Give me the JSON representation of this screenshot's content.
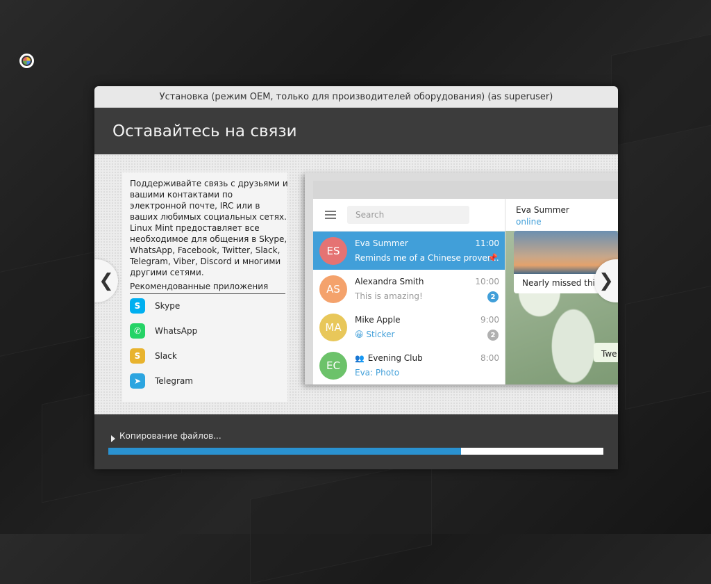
{
  "window": {
    "title": "Установка (режим OEM, только для производителей оборудования) (as superuser)"
  },
  "header": {
    "title": "Оставайтесь на связи"
  },
  "slide": {
    "description": "Поддерживайте связь с друзьями и вашими контактами по электронной почте, IRC или в ваших любимых социальных сетях. Linux Mint предоставляет все необходимое для общения в Skype, WhatsApp, Facebook, Twitter, Slack, Telegram, Viber, Discord и многими другими сетями.",
    "recommended_title": "Рекомендованные приложения",
    "apps": [
      {
        "name": "Skype",
        "icon": "skype-icon",
        "color": "#00aff0",
        "glyph": "S"
      },
      {
        "name": "WhatsApp",
        "icon": "whatsapp-icon",
        "color": "#25d366",
        "glyph": "✆"
      },
      {
        "name": "Slack",
        "icon": "slack-icon",
        "color": "#e8b32e",
        "glyph": "S"
      },
      {
        "name": "Telegram",
        "icon": "telegram-icon",
        "color": "#2ca5e0",
        "glyph": "➤"
      }
    ],
    "mock": {
      "search_placeholder": "Search",
      "chats": [
        {
          "initials": "ES",
          "name": "Eva Summer",
          "time": "11:00",
          "msg": "Reminds me of a Chinese prover…",
          "avatar_color": "#e57373",
          "active": true,
          "pinned": true
        },
        {
          "initials": "AS",
          "name": "Alexandra Smith",
          "time": "10:00",
          "msg": "This is amazing!",
          "avatar_color": "#f4a26c",
          "badge": "2",
          "badge_color": "#419fd9"
        },
        {
          "initials": "MA",
          "name": "Mike Apple",
          "time": "9:00",
          "msg": "😀 Sticker",
          "avatar_color": "#e8c75a",
          "badge": "2",
          "badge_color": "#b0b0b0"
        },
        {
          "initials": "EC",
          "name": "Evening Club",
          "time": "8:00",
          "msg": "Eva: Photo",
          "avatar_color": "#6cc26a",
          "group": true
        }
      ],
      "chat_header_name": "Eva Summer",
      "chat_header_status": "online",
      "photo_caption": "Nearly missed this s",
      "tw_text": "Twe"
    },
    "prev_glyph": "❮",
    "next_glyph": "❯"
  },
  "footer": {
    "status": "Копирование файлов...",
    "progress": 0.712
  }
}
